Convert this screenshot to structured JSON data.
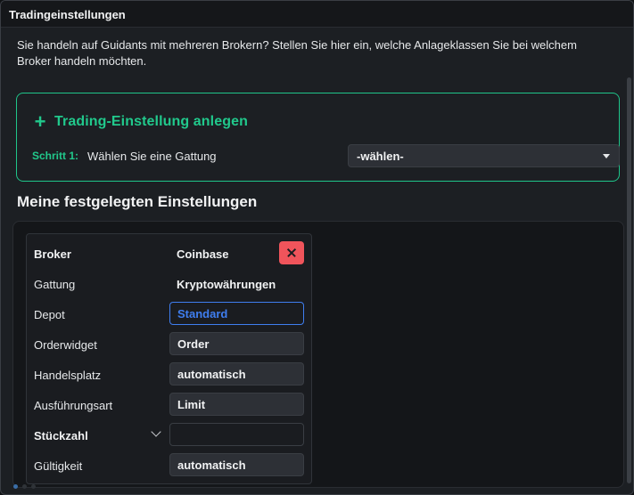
{
  "window": {
    "title": "Tradingeinstellungen"
  },
  "intro": {
    "text": "Sie handeln auf Guidants mit mehreren Brokern? Stellen Sie hier ein, welche Anlageklassen Sie bei welchem Broker handeln möchten."
  },
  "create": {
    "icon": "plus-icon",
    "title": "Trading-Einstellung anlegen",
    "step_label": "Schritt 1:",
    "step_text": "Wählen Sie eine Gattung",
    "select_value": "-wählen-"
  },
  "section": {
    "title": "Meine festgelegten Einstellungen"
  },
  "card": {
    "broker_label": "Broker",
    "broker_value": "Coinbase",
    "gattung_label": "Gattung",
    "gattung_value": "Kryptowährungen",
    "depot_label": "Depot",
    "depot_value": "Standard",
    "orderwidget_label": "Orderwidget",
    "orderwidget_value": "Order",
    "handelsplatz_label": "Handelsplatz",
    "handelsplatz_value": "automatisch",
    "ausfuehrungsart_label": "Ausführungsart",
    "ausfuehrungsart_value": "Limit",
    "stueckzahl_label": "Stückzahl",
    "stueckzahl_value": "",
    "gueltigkeit_label": "Gültigkeit",
    "gueltigkeit_value": "automatisch"
  },
  "colors": {
    "accent": "#21c98c",
    "active_border": "#3f7ef0",
    "danger": "#f0545b",
    "background": "#1c1f23"
  }
}
